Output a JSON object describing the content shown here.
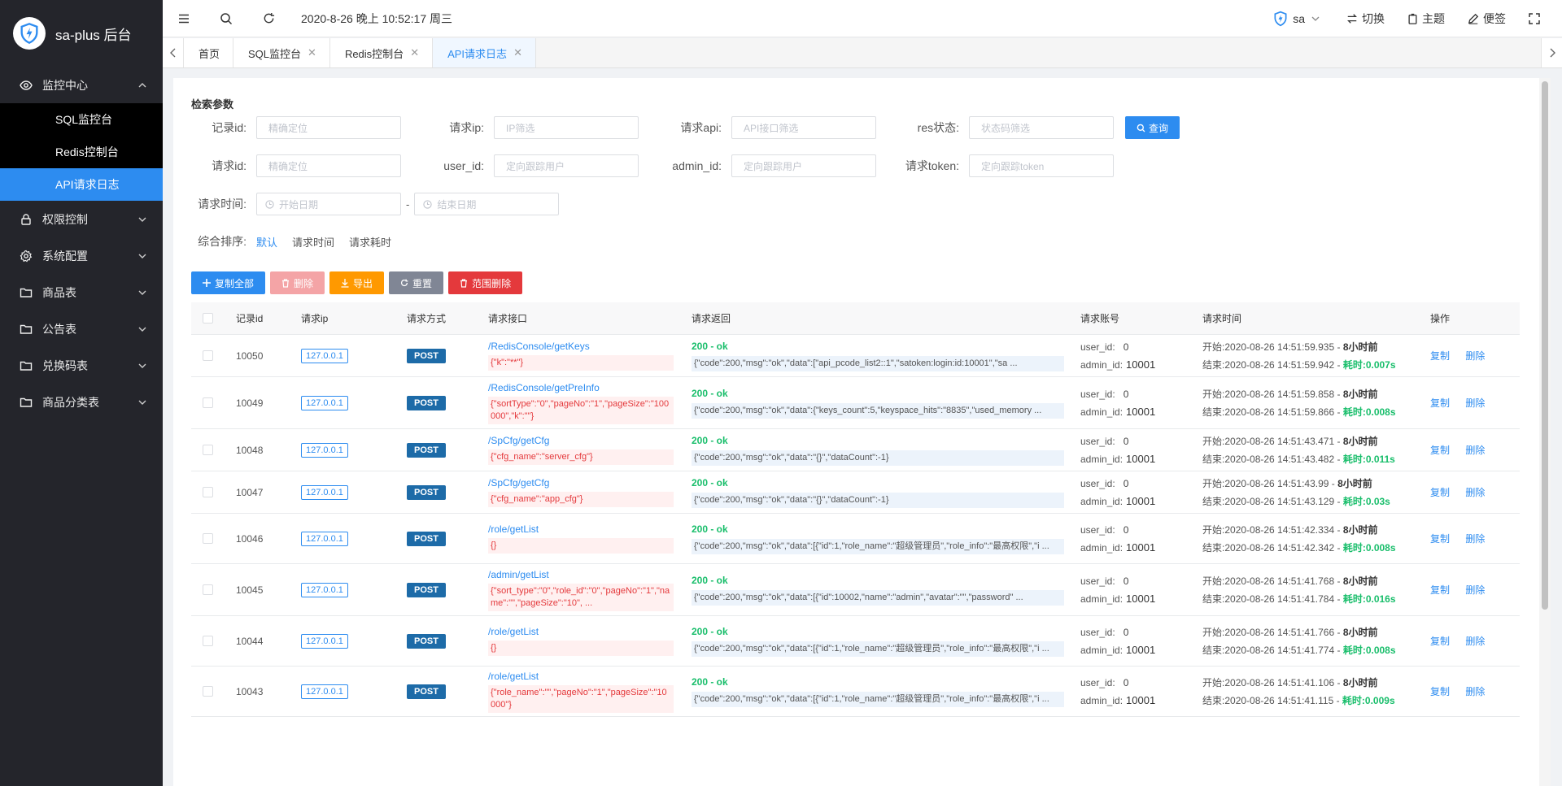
{
  "app": {
    "title": "sa-plus 后台"
  },
  "sidebar": {
    "groups": [
      {
        "label": "监控中心",
        "icon": "eye-icon",
        "expanded": true,
        "items": [
          {
            "label": "SQL监控台"
          },
          {
            "label": "Redis控制台"
          },
          {
            "label": "API请求日志",
            "active": true
          }
        ]
      },
      {
        "label": "权限控制",
        "icon": "lock-icon"
      },
      {
        "label": "系统配置",
        "icon": "gear-icon"
      },
      {
        "label": "商品表",
        "icon": "folder-icon"
      },
      {
        "label": "公告表",
        "icon": "folder-icon"
      },
      {
        "label": "兑换码表",
        "icon": "folder-icon"
      },
      {
        "label": "商品分类表",
        "icon": "folder-icon"
      }
    ]
  },
  "topbar": {
    "datetime": "2020-8-26 晚上 10:52:17 周三",
    "user": "sa",
    "switch_label": "切换",
    "theme_label": "主题",
    "note_label": "便签"
  },
  "tabs": [
    {
      "label": "首页",
      "closable": false
    },
    {
      "label": "SQL监控台",
      "closable": true
    },
    {
      "label": "Redis控制台",
      "closable": true
    },
    {
      "label": "API请求日志",
      "closable": true,
      "active": true
    }
  ],
  "search": {
    "title": "检索参数",
    "fields": {
      "record_id": {
        "label": "记录id:",
        "placeholder": "精确定位"
      },
      "req_ip": {
        "label": "请求ip:",
        "placeholder": "IP筛选"
      },
      "req_api": {
        "label": "请求api:",
        "placeholder": "API接口筛选"
      },
      "res_status": {
        "label": "res状态:",
        "placeholder": "状态码筛选"
      },
      "req_id": {
        "label": "请求id:",
        "placeholder": "精确定位"
      },
      "user_id": {
        "label": "user_id:",
        "placeholder": "定向跟踪用户"
      },
      "admin_id": {
        "label": "admin_id:",
        "placeholder": "定向跟踪用户"
      },
      "req_token": {
        "label": "请求token:",
        "placeholder": "定向跟踪token"
      },
      "req_time": {
        "label": "请求时间:",
        "start_placeholder": "开始日期",
        "end_placeholder": "结束日期",
        "separator": "-"
      }
    },
    "query_button": "查询",
    "sort": {
      "label": "综合排序:",
      "options": [
        "默认",
        "请求时间",
        "请求耗时"
      ],
      "active": "默认"
    }
  },
  "actions": {
    "copy_all": "复制全部",
    "delete": "删除",
    "export": "导出",
    "reset": "重置",
    "range_delete": "范围删除"
  },
  "colors": {
    "primary": "#2d8cf0",
    "success": "#19be6b",
    "danger": "#e4393c",
    "warning": "#ff9900",
    "disabled_danger": "#f4a4a6",
    "gray": "#808695",
    "sidebar_bg": "#24252b"
  },
  "table": {
    "columns": [
      "记录id",
      "请求ip",
      "请求方式",
      "请求接口",
      "请求返回",
      "请求账号",
      "请求时间",
      "操作"
    ],
    "labels": {
      "user_id": "user_id:",
      "admin_id": "admin_id:",
      "start": "开始:",
      "end": "结束:",
      "cost": "耗时:",
      "copy": "复制",
      "delete": "删除"
    },
    "rows": [
      {
        "id": "10050",
        "ip": "127.0.0.1",
        "method": "POST",
        "api": "/RedisConsole/getKeys",
        "params": "{\"k\":\"**\"}",
        "status": "200 - ok",
        "ret": "{\"code\":200,\"msg\":\"ok\",\"data\":[\"api_pcode_list2::1\",\"satoken:login:id:10001\",\"sa ...",
        "user_id": "0",
        "admin_id": "10001",
        "start": "2020-08-26 14:51:59.935",
        "ago": "8小时前",
        "end": "2020-08-26 14:51:59.942",
        "cost": "0.007s"
      },
      {
        "id": "10049",
        "ip": "127.0.0.1",
        "method": "POST",
        "api": "/RedisConsole/getPreInfo",
        "params": "{\"sortType\":\"0\",\"pageNo\":\"1\",\"pageSize\":\"100000\",\"k\":\"\"}",
        "status": "200 - ok",
        "ret": "{\"code\":200,\"msg\":\"ok\",\"data\":{\"keys_count\":5,\"keyspace_hits\":\"8835\",\"used_memory ...",
        "user_id": "0",
        "admin_id": "10001",
        "start": "2020-08-26 14:51:59.858",
        "ago": "8小时前",
        "end": "2020-08-26 14:51:59.866",
        "cost": "0.008s"
      },
      {
        "id": "10048",
        "ip": "127.0.0.1",
        "method": "POST",
        "api": "/SpCfg/getCfg",
        "params": "{\"cfg_name\":\"server_cfg\"}",
        "status": "200 - ok",
        "ret": "{\"code\":200,\"msg\":\"ok\",\"data\":\"{}\",\"dataCount\":-1}",
        "user_id": "0",
        "admin_id": "10001",
        "start": "2020-08-26 14:51:43.471",
        "ago": "8小时前",
        "end": "2020-08-26 14:51:43.482",
        "cost": "0.011s"
      },
      {
        "id": "10047",
        "ip": "127.0.0.1",
        "method": "POST",
        "api": "/SpCfg/getCfg",
        "params": "{\"cfg_name\":\"app_cfg\"}",
        "status": "200 - ok",
        "ret": "{\"code\":200,\"msg\":\"ok\",\"data\":\"{}\",\"dataCount\":-1}",
        "user_id": "0",
        "admin_id": "10001",
        "start": "2020-08-26 14:51:43.99",
        "ago": "8小时前",
        "end": "2020-08-26 14:51:43.129",
        "cost": "0.03s"
      },
      {
        "id": "10046",
        "ip": "127.0.0.1",
        "method": "POST",
        "api": "/role/getList",
        "params": "{}",
        "status": "200 - ok",
        "ret": "{\"code\":200,\"msg\":\"ok\",\"data\":[{\"id\":1,\"role_name\":\"超级管理员\",\"role_info\":\"最高权限\",\"i ...",
        "user_id": "0",
        "admin_id": "10001",
        "start": "2020-08-26 14:51:42.334",
        "ago": "8小时前",
        "end": "2020-08-26 14:51:42.342",
        "cost": "0.008s"
      },
      {
        "id": "10045",
        "ip": "127.0.0.1",
        "method": "POST",
        "api": "/admin/getList",
        "params": "{\"sort_type\":\"0\",\"role_id\":\"0\",\"pageNo\":\"1\",\"name\":\"\",\"pageSize\":\"10\", ...",
        "status": "200 - ok",
        "ret": "{\"code\":200,\"msg\":\"ok\",\"data\":[{\"id\":10002,\"name\":\"admin\",\"avatar\":\"\",\"password\" ...",
        "user_id": "0",
        "admin_id": "10001",
        "start": "2020-08-26 14:51:41.768",
        "ago": "8小时前",
        "end": "2020-08-26 14:51:41.784",
        "cost": "0.016s"
      },
      {
        "id": "10044",
        "ip": "127.0.0.1",
        "method": "POST",
        "api": "/role/getList",
        "params": "{}",
        "status": "200 - ok",
        "ret": "{\"code\":200,\"msg\":\"ok\",\"data\":[{\"id\":1,\"role_name\":\"超级管理员\",\"role_info\":\"最高权限\",\"i ...",
        "user_id": "0",
        "admin_id": "10001",
        "start": "2020-08-26 14:51:41.766",
        "ago": "8小时前",
        "end": "2020-08-26 14:51:41.774",
        "cost": "0.008s"
      },
      {
        "id": "10043",
        "ip": "127.0.0.1",
        "method": "POST",
        "api": "/role/getList",
        "params": "{\"role_name\":\"\",\"pageNo\":\"1\",\"pageSize\":\"10000\"}",
        "status": "200 - ok",
        "ret": "{\"code\":200,\"msg\":\"ok\",\"data\":[{\"id\":1,\"role_name\":\"超级管理员\",\"role_info\":\"最高权限\",\"i ...",
        "user_id": "0",
        "admin_id": "10001",
        "start": "2020-08-26 14:51:41.106",
        "ago": "8小时前",
        "end": "2020-08-26 14:51:41.115",
        "cost": "0.009s"
      }
    ]
  }
}
